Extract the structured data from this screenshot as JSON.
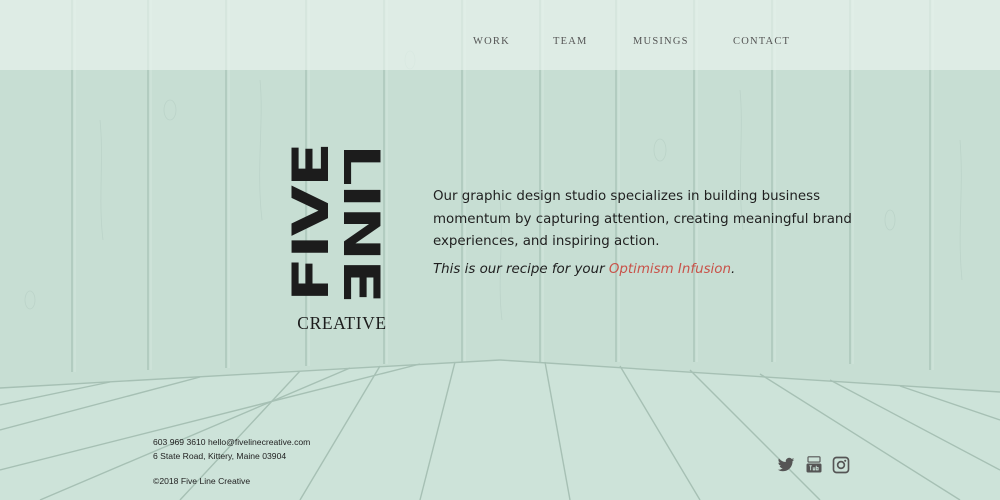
{
  "nav": {
    "items": [
      "WORK",
      "TEAM",
      "MUSINGS",
      "CONTACT"
    ]
  },
  "logo": {
    "word_1": "FIVE",
    "word_2": "LINE",
    "subtitle": "CREATIVE"
  },
  "intro": {
    "text": "Our graphic design studio specializes in building business momentum by capturing attention, creating meaningful brand experiences, and inspiring action.",
    "recipe_prefix": "This is our recipe for your ",
    "recipe_link": "Optimism Infusion",
    "recipe_suffix": "."
  },
  "footer": {
    "contact_line": "603 969 3610 hello@fivelinecreative.com",
    "address": "6 State Road, Kittery, Maine 03904",
    "copyright": "©2018 Five Line Creative"
  },
  "social": [
    {
      "icon": "twitter-icon"
    },
    {
      "icon": "youtube-icon"
    },
    {
      "icon": "instagram-icon"
    }
  ],
  "colors": {
    "background": "#c9e0d6",
    "accent": "#c8534a",
    "text": "#1c1c1c"
  }
}
